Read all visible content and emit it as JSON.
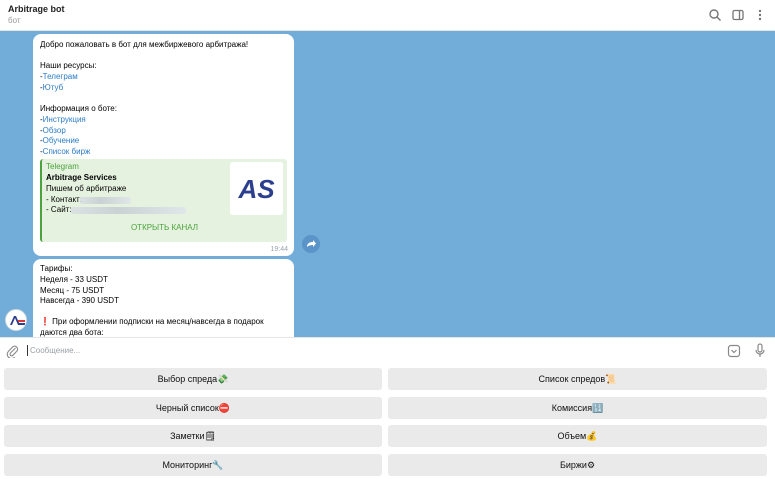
{
  "header": {
    "title": "Arbitrage bot",
    "subtitle": "бот"
  },
  "message1": {
    "lines": [
      "Добро пожаловать в бот для межбиржевого арбитража!",
      "Наши ресурсы:",
      "Информация о боте:"
    ],
    "resources": [
      {
        "dash": "-",
        "link": "Телеграм"
      },
      {
        "dash": "-",
        "link": "Ютуб"
      }
    ],
    "info_links": [
      {
        "dash": "-",
        "link": "Инструкция"
      },
      {
        "dash": "-",
        "link": "Обзор"
      },
      {
        "dash": "-",
        "link": "Обучение"
      },
      {
        "dash": "-",
        "link": "Список бирж"
      }
    ],
    "preview": {
      "source": "Telegram",
      "title": "Arbitrage Services",
      "description": "Пишем об арбитраже",
      "contact_label": "- Контакт:",
      "site_label": "- Сайт:",
      "button": "ОТКРЫТЬ КАНАЛ",
      "thumb_text": "AS"
    },
    "time": "19:44"
  },
  "message2": {
    "lines": [
      "Тарифы:",
      "Неделя - 33 USDT",
      "Месяц - 75 USDT",
      "Навсегда - 390 USDT",
      "❗ При оформлении подписки на месяц/навсегда в подарок",
      "даются два бота:"
    ]
  },
  "composer": {
    "placeholder": "Сообщение..."
  },
  "keyboard": {
    "rows": [
      [
        "Выбор спреда💸",
        "Список спредов📜"
      ],
      [
        "Черный список⛔",
        "Комиссия🔢"
      ],
      [
        "Заметки🗒",
        "Объем💰"
      ],
      [
        "Мониторинг🔧",
        "Биржи⚙"
      ]
    ]
  },
  "colors": {
    "chat_bg": "#72add9",
    "link": "#2a7cc7",
    "preview_accent": "#4aa33c",
    "button_bg": "#eaeaea"
  }
}
